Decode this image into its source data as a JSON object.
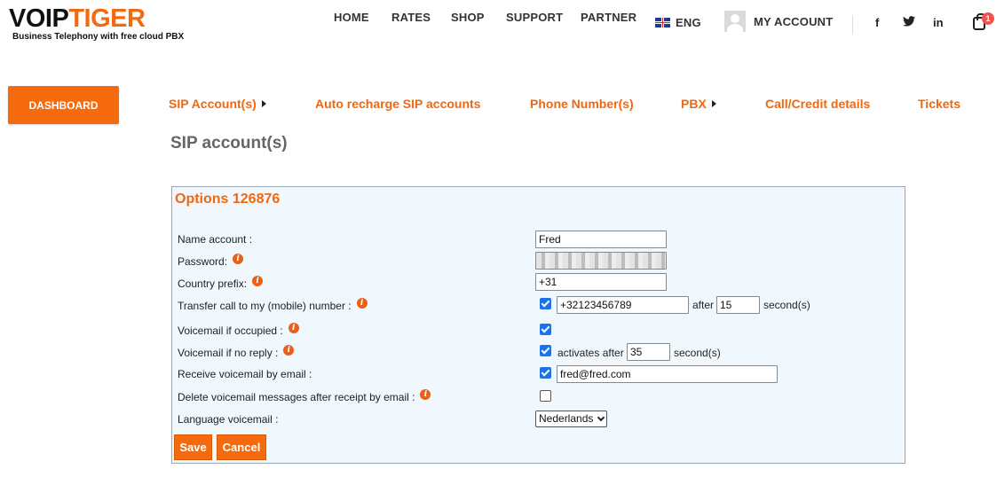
{
  "logo": {
    "part1": "VOIP",
    "part2": "TIGER",
    "tagline": "Business Telephony with free cloud PBX"
  },
  "topnav": {
    "home": "HOME",
    "rates": "RATES",
    "shop": "SHOP",
    "support": "SUPPORT",
    "partner": "PARTNER",
    "language": "ENG",
    "account": "MY ACCOUNT",
    "social": {
      "facebook": "f",
      "twitter": "🐦",
      "linkedin": "in"
    },
    "cart_count": "1"
  },
  "subnav": {
    "dashboard": "DASHBOARD",
    "items": [
      "SIP Account(s)",
      "Auto recharge SIP accounts",
      "Phone Number(s)",
      "PBX",
      "Call/Credit details",
      "Tickets"
    ]
  },
  "page_title": "SIP account(s)",
  "options": {
    "title": "Options 126876",
    "labels": {
      "name": "Name account :",
      "password": "Password:",
      "country_prefix": "Country prefix:",
      "transfer": "Transfer call to my (mobile) number :",
      "vm_occupied": "Voicemail if occupied :",
      "vm_noreply": "Voicemail if no reply :",
      "vm_email": "Receive voicemail by email :",
      "vm_delete": "Delete voicemail messages after receipt by email :",
      "vm_language": "Language voicemail :"
    },
    "values": {
      "name": "Fred",
      "country_prefix": "+31",
      "transfer_number": "+32123456789",
      "transfer_after": "15",
      "noreply_after": "35",
      "email": "fred@fred.com",
      "language": "Nederlands"
    },
    "text": {
      "after": "after",
      "seconds": "second(s)",
      "activates_after": "activates after"
    },
    "checkboxes": {
      "transfer": true,
      "vm_occupied": true,
      "vm_noreply": true,
      "vm_email": true,
      "vm_delete": false
    },
    "save": "Save",
    "cancel": "Cancel"
  },
  "colors": {
    "accent": "#f56a0c",
    "panel_bg": "#f0f8fd",
    "checkbox": "#1a73e8"
  }
}
